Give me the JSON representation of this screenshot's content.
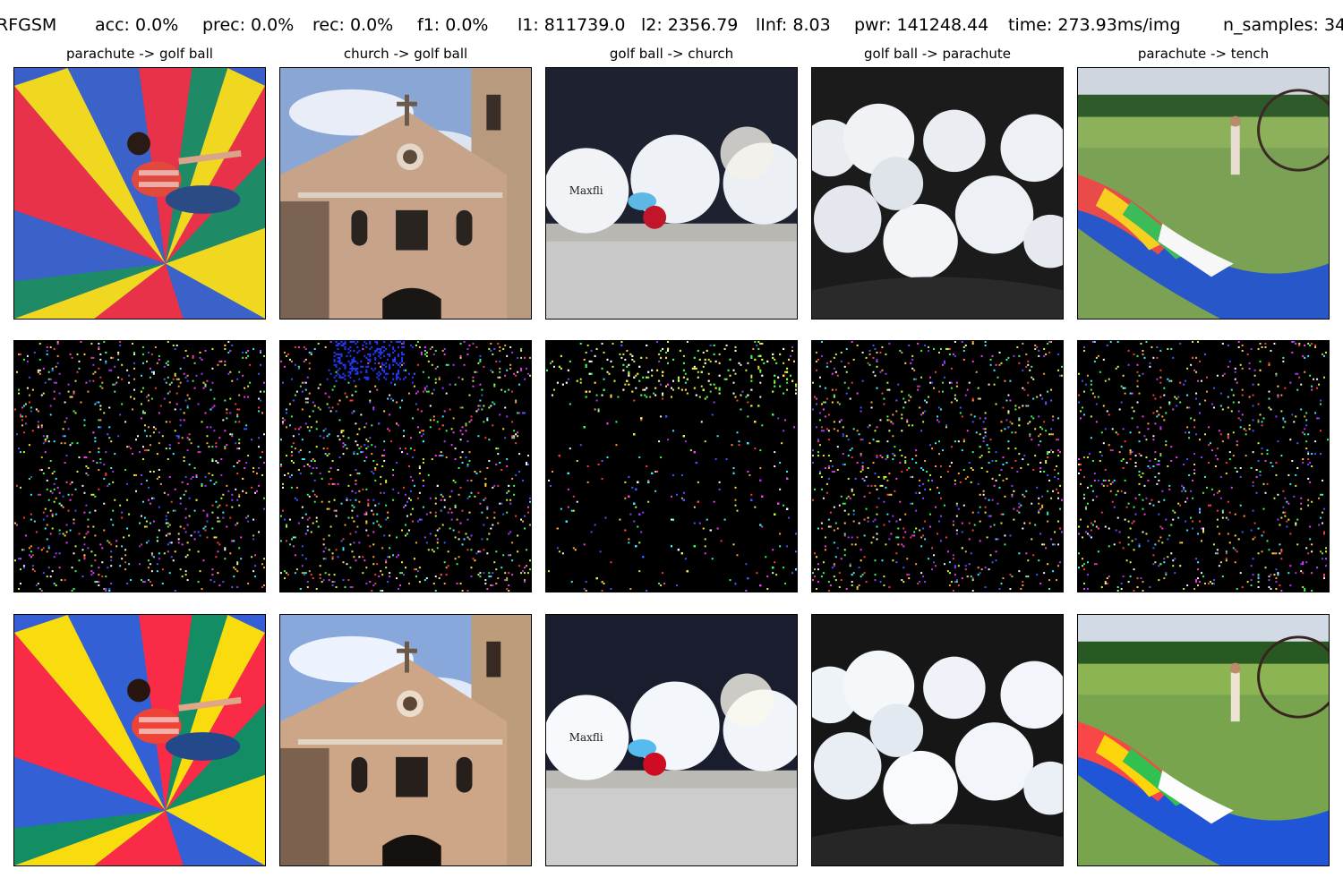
{
  "header": {
    "method": "RFGSM",
    "acc": "acc: 0.0%",
    "prec": "prec: 0.0%",
    "rec": "rec: 0.0%",
    "f1": "f1: 0.0%",
    "l1": "l1: 811739.0",
    "l2": "l2: 2356.79",
    "linf": "lInf: 8.03",
    "pwr": "pwr: 141248.44",
    "time": "time: 273.93ms/img",
    "n_samples": "n_samples: 34"
  },
  "columns": [
    {
      "title": "parachute -> golf ball",
      "image": "parachute-with-child"
    },
    {
      "title": "church -> golf ball",
      "image": "church-facade"
    },
    {
      "title": "golf ball -> church",
      "image": "golf-balls-on-carpet"
    },
    {
      "title": "golf ball -> parachute",
      "image": "golf-balls-in-basket"
    },
    {
      "title": "parachute -> tench",
      "image": "paraglider-on-field"
    }
  ],
  "rows": [
    "original",
    "perturbation",
    "adversarial"
  ],
  "colors": {
    "background": "#ffffff",
    "perturbation_bg": "#000000"
  }
}
